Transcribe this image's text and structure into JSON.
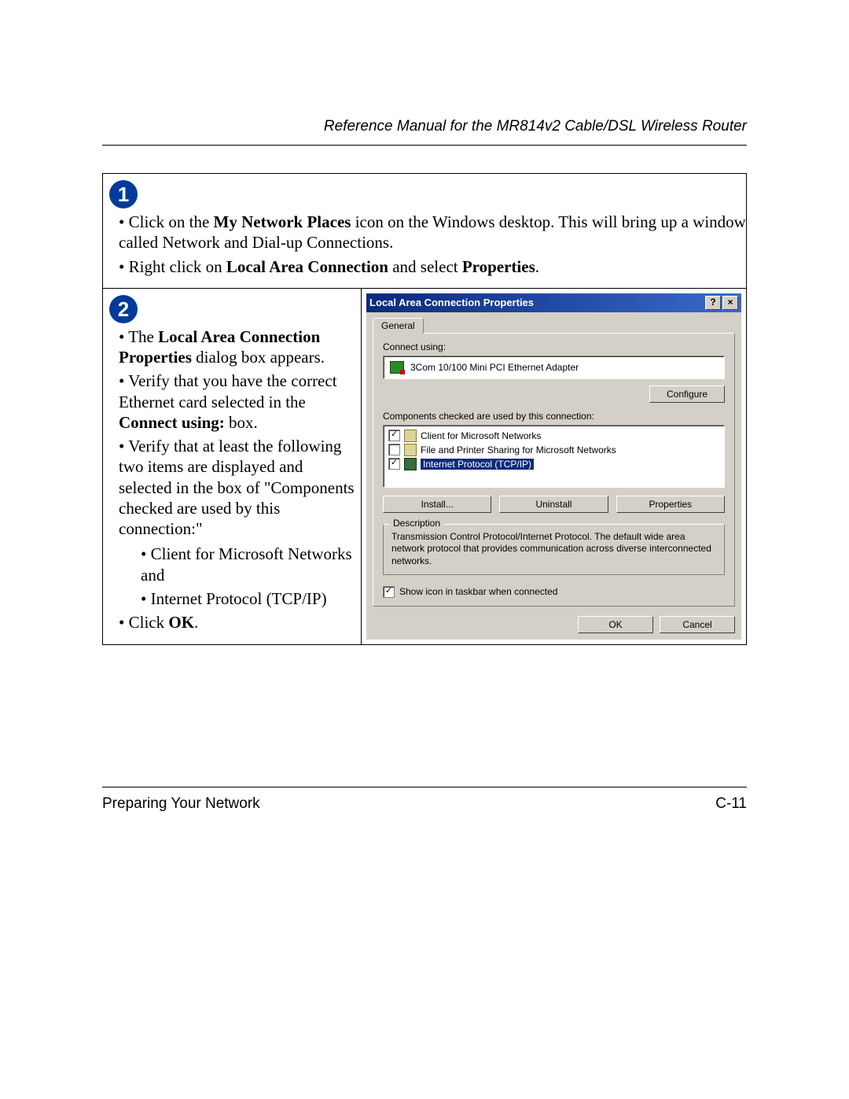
{
  "header": {
    "title": "Reference Manual for the MR814v2 Cable/DSL Wireless Router"
  },
  "step1": {
    "badge": "1",
    "bullets": {
      "b1_pre": "Click on the ",
      "b1_bold": "My Network Places",
      "b1_post": " icon on the Windows desktop.  This will bring up a window called Network and Dial-up Connections.",
      "b2_pre": "Right click on ",
      "b2_bold1": "Local Area Connection",
      "b2_mid": " and select ",
      "b2_bold2": "Properties",
      "b2_post": "."
    }
  },
  "step2": {
    "badge": "2",
    "bullets": {
      "b1_pre": "The ",
      "b1_bold": "Local Area Connection Properties",
      "b1_post": " dialog box appears.",
      "b2_pre": "Verify that you have the correct Ethernet card selected in the ",
      "b2_bold": "Connect using:",
      "b2_post": " box.",
      "b3": "Verify that at least the following two items are displayed and selected in the box of \"Components checked are used by this connection:\"",
      "sub1": "Client for Microsoft Networks and",
      "sub2": "Internet Protocol (TCP/IP)",
      "b4_pre": "Click ",
      "b4_bold": "OK",
      "b4_post": "."
    }
  },
  "dialog": {
    "title": "Local Area Connection Properties",
    "help_btn": "?",
    "close_btn": "×",
    "tab": "General",
    "connect_label": "Connect using:",
    "adapter": "3Com 10/100 Mini PCI Ethernet Adapter",
    "configure_btn": "Configure",
    "components_label": "Components checked are used by this connection:",
    "components": {
      "c1": {
        "checked": "✓",
        "label": "Client for Microsoft Networks"
      },
      "c2": {
        "checked": "",
        "label": "File and Printer Sharing for Microsoft Networks"
      },
      "c3": {
        "checked": "✓",
        "label": "Internet Protocol (TCP/IP)"
      }
    },
    "install_btn": "Install...",
    "uninstall_btn": "Uninstall",
    "properties_btn": "Properties",
    "description_title": "Description",
    "description_text": "Transmission Control Protocol/Internet Protocol. The default wide area network protocol that provides communication across diverse interconnected networks.",
    "show_icon_checked": "✓",
    "show_icon_label": "Show icon in taskbar when connected",
    "ok_btn": "OK",
    "cancel_btn": "Cancel"
  },
  "footer": {
    "left": "Preparing Your Network",
    "right": "C-11"
  }
}
